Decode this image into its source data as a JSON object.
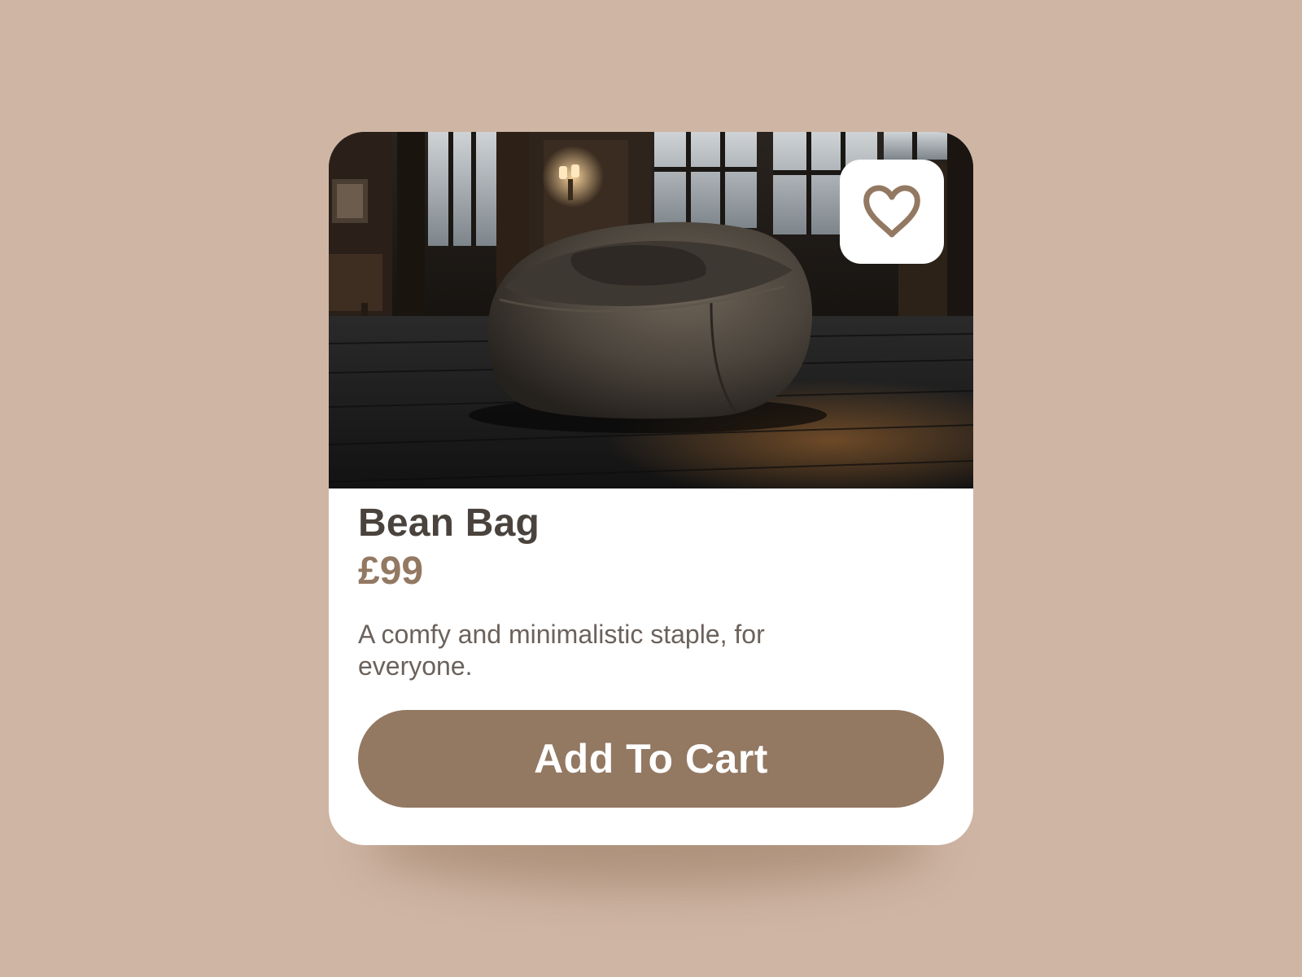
{
  "product": {
    "name": "Bean Bag",
    "price": "£99",
    "description": "A comfy and minimalistic staple, for everyone.",
    "image_alt": "Bean bag chair on a wooden floor in a dim room",
    "cart_button_label": "Add To Cart",
    "wishlist_icon": "heart-outline-icon"
  },
  "colors": {
    "background": "#cfb5a4",
    "accent": "#937862",
    "heading": "#4a433d",
    "body_text": "#6b625c",
    "card": "#ffffff"
  }
}
